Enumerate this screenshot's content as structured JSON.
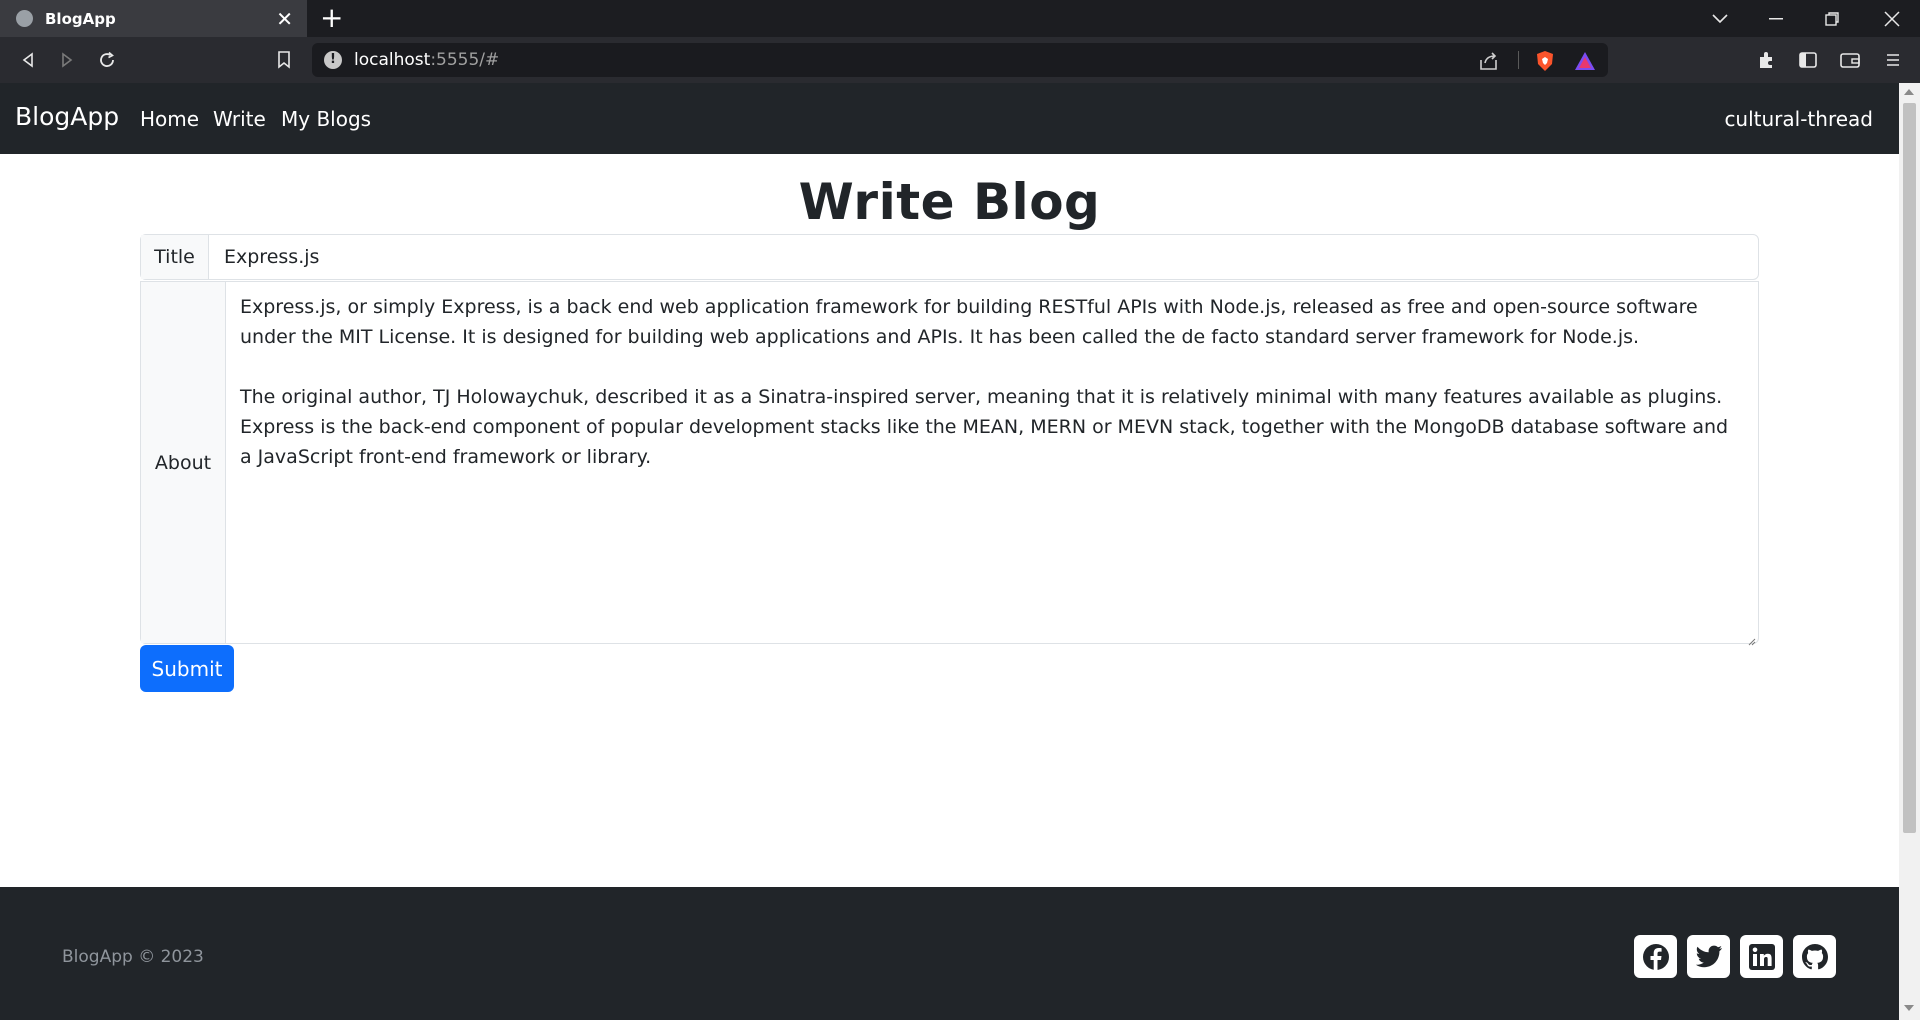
{
  "browser": {
    "tab_title": "BlogApp",
    "new_tab_symbol": "+",
    "url_host": "localhost",
    "url_rest": ":5555/#"
  },
  "navbar": {
    "brand": "BlogApp",
    "links": [
      "Home",
      "Write",
      "My Blogs"
    ],
    "username": "cultural-thread"
  },
  "page": {
    "heading": "Write Blog",
    "title_label": "Title",
    "title_value": "Express.js",
    "about_label": "About",
    "about_paragraphs": [
      "Express.js, or simply Express, is a back end web application framework for building RESTful APIs with Node.js, released as free and open-source software under the MIT License. It is designed for building web applications and APIs. It has been called the de facto standard server framework for Node.js.",
      "The original author, TJ Holowaychuk, described it as a Sinatra-inspired server, meaning that it is relatively minimal with many features available as plugins. Express is the back-end component of popular development stacks like the MEAN, MERN or MEVN stack, together with the MongoDB database software and a JavaScript front-end framework or library."
    ],
    "submit_label": "Submit"
  },
  "footer": {
    "copyright": "BlogApp © 2023",
    "social_icons": [
      "facebook-icon",
      "twitter-icon",
      "linkedin-icon",
      "github-icon"
    ]
  },
  "colors": {
    "navbar_bg": "#212529",
    "primary": "#0d6efd",
    "footer_text": "#8f959c"
  }
}
